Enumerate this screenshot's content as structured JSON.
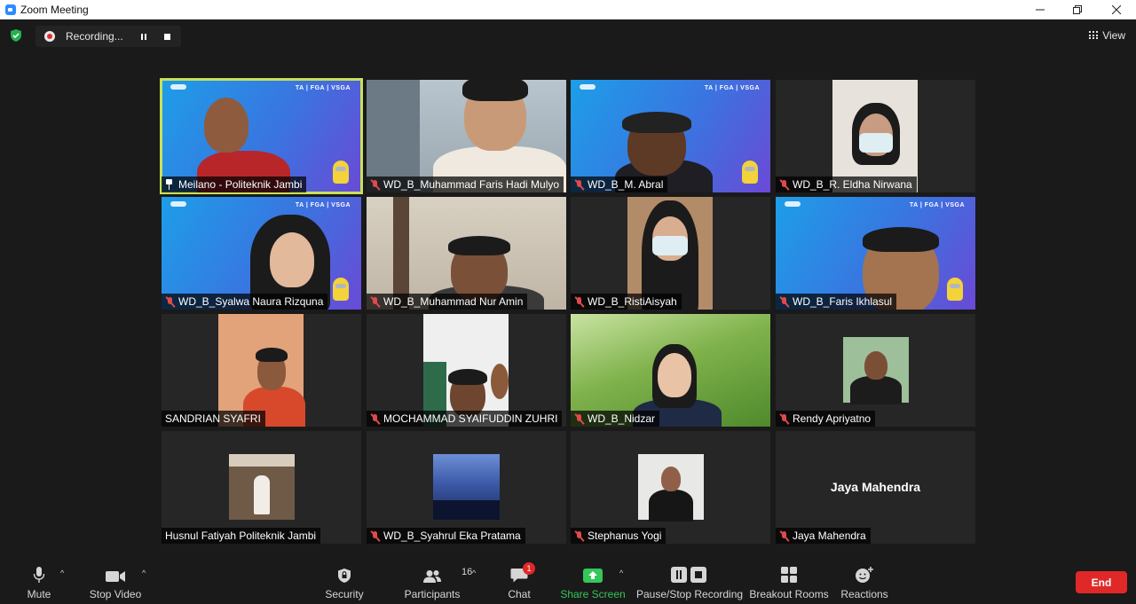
{
  "window": {
    "title": "Zoom Meeting",
    "controls": [
      "minimize",
      "restore",
      "close"
    ]
  },
  "top_bar": {
    "recording_label": "Recording...",
    "view_label": "View"
  },
  "participants": [
    {
      "name": "Meilano - Politeknik Jambi",
      "muted": false,
      "pinned": true,
      "active_speaker": true
    },
    {
      "name": "WD_B_Muhammad Faris Hadi Mulyo",
      "muted": true
    },
    {
      "name": "WD_B_M. Abral",
      "muted": true
    },
    {
      "name": "WD_B_R. Eldha Nirwana",
      "muted": true
    },
    {
      "name": "WD_B_Syalwa Naura Rizquna",
      "muted": true
    },
    {
      "name": "WD_B_Muhammad Nur Amin",
      "muted": true
    },
    {
      "name": "WD_B_RistiAisyah",
      "muted": true
    },
    {
      "name": "WD_B_Faris Ikhlasul",
      "muted": true
    },
    {
      "name": "SANDRIAN SYAFRI",
      "muted": false
    },
    {
      "name": "MOCHAMMAD SYAIFUDDIN ZUHRI",
      "muted": true
    },
    {
      "name": "WD_B_Nidzar",
      "muted": true
    },
    {
      "name": "Rendy Apriyatno",
      "muted": true
    },
    {
      "name": "Husnul Fatiyah Politeknik Jambi",
      "muted": false
    },
    {
      "name": "WD_B_Syahrul Eka Pratama",
      "muted": true
    },
    {
      "name": "Stephanus Yogi",
      "muted": true
    },
    {
      "name": "Jaya Mahendra",
      "muted": true,
      "video_off_label": "Jaya Mahendra"
    }
  ],
  "banner": {
    "text": "TA | FGA | VSGA"
  },
  "toolbar": {
    "mute": "Mute",
    "stop_video": "Stop Video",
    "security": "Security",
    "participants": "Participants",
    "participants_count": "16",
    "chat": "Chat",
    "chat_badge": "1",
    "share_screen": "Share Screen",
    "pause_stop_recording": "Pause/Stop Recording",
    "breakout_rooms": "Breakout Rooms",
    "reactions": "Reactions",
    "end": "End"
  },
  "colors": {
    "background": "#1a1a1a",
    "active_speaker_border": "#c8e05a",
    "end_button": "#e02828",
    "share_screen": "#34c759",
    "muted_mic": "#e04a4a"
  }
}
